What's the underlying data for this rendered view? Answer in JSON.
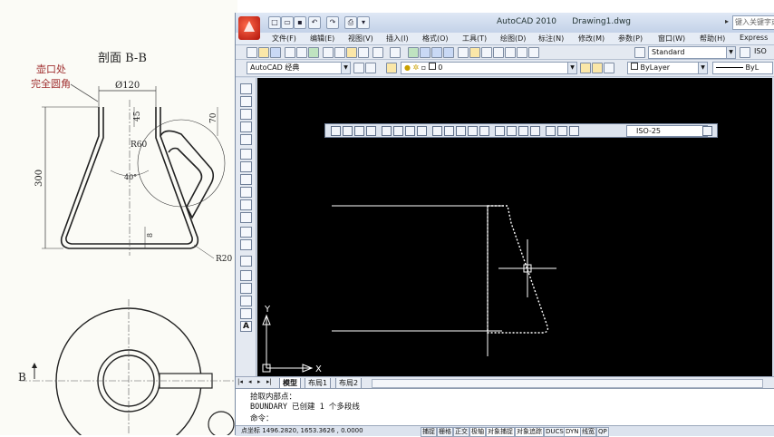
{
  "reference": {
    "section_title": "剖面 B-B",
    "note_line1": "壶口处",
    "note_line2": "完全圆角",
    "dim_top": "Ø120",
    "dim_height": "300",
    "dim_45": "45",
    "dim_70": "70",
    "dim_r60": "R60",
    "dim_angle": "40°",
    "dim_8": "8",
    "dim_r20": "R20",
    "section_marker": "B"
  },
  "window": {
    "title": "AutoCAD 2010",
    "document": "Drawing1.dwg",
    "search_placeholder": "键入关键字或短语"
  },
  "quick_access": [
    "new",
    "open",
    "save",
    "undo",
    "redo",
    "print"
  ],
  "menu": [
    "文件(F)",
    "编辑(E)",
    "视图(V)",
    "插入(I)",
    "格式(O)",
    "工具(T)",
    "绘图(D)",
    "标注(N)",
    "修改(M)",
    "参数(P)",
    "窗口(W)",
    "帮助(H)",
    "Express"
  ],
  "toolbar": {
    "text_style": "Standard",
    "text_style_extra": "ISO",
    "workspace": "AutoCAD 经典",
    "layer": "0",
    "color": "ByLayer",
    "linetype": "ByL"
  },
  "dim_toolbar": {
    "dim_style": "ISO-25"
  },
  "ucs": {
    "y_label": "Y",
    "x_label": "X"
  },
  "tabs": [
    "模型",
    "布局1",
    "布局2"
  ],
  "command": {
    "line1": "拾取内部点：",
    "line2": "BOUNDARY 已创建 1 个多段线",
    "prompt": "命令："
  },
  "status": {
    "coords": "1496.2820, 1653.3626 , 0.0000",
    "coords_label": "点坐标",
    "toggles": [
      "捕捉",
      "栅格",
      "正交",
      "极轴",
      "对象捕捉",
      "对象追踪",
      "DUCS",
      "DYN",
      "线宽",
      "QP"
    ]
  },
  "colors": {
    "canvas": "#000000",
    "drawing_lines": "#ffffff",
    "accent_logo": "#c0180c"
  }
}
